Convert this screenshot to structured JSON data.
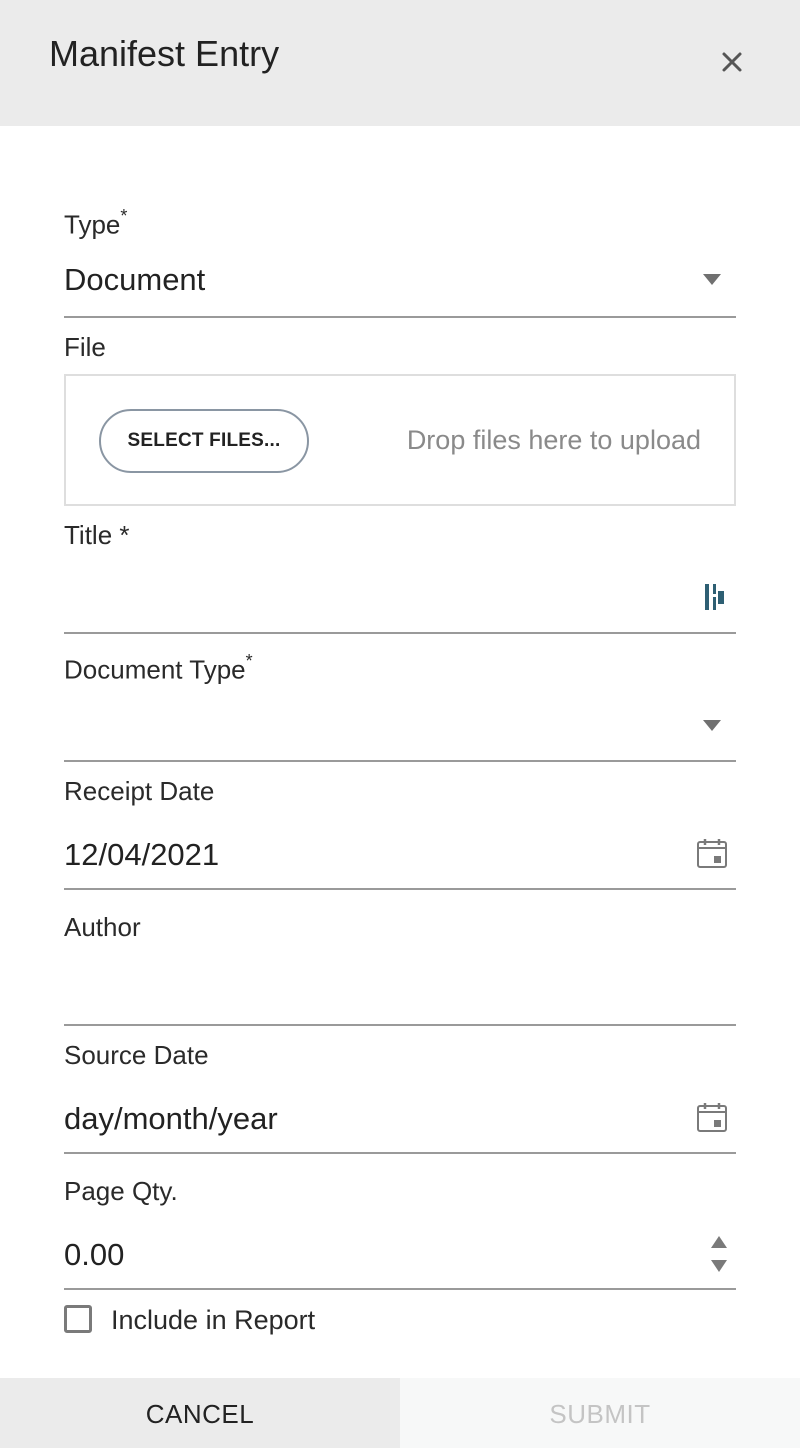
{
  "header": {
    "title": "Manifest Entry",
    "close_icon": "close-icon"
  },
  "form": {
    "type": {
      "label": "Type",
      "required_mark": "*",
      "value": "Document",
      "icon": "dropdown-arrow-icon"
    },
    "file": {
      "label": "File",
      "select_button": "SELECT FILES...",
      "drop_text": "Drop files here to upload"
    },
    "title": {
      "label": "Title *",
      "value": "",
      "icon": "password-manager-icon"
    },
    "document_type": {
      "label": "Document Type",
      "required_mark": "*",
      "value": "",
      "icon": "dropdown-arrow-icon"
    },
    "receipt_date": {
      "label": "Receipt Date",
      "value": "12/04/2021",
      "icon": "calendar-icon"
    },
    "author": {
      "label": "Author",
      "value": ""
    },
    "source_date": {
      "label": "Source Date",
      "placeholder": "day/month/year",
      "icon": "calendar-icon"
    },
    "page_qty": {
      "label": "Page Qty.",
      "value": "0.00",
      "icon": "spinner-arrows-icon"
    },
    "include_in_report": {
      "label": "Include in Report",
      "checked": false
    }
  },
  "footer": {
    "cancel_label": "CANCEL",
    "submit_label": "SUBMIT"
  },
  "colors": {
    "header_bg": "#ebebeb",
    "field_underline": "#9a9a9a",
    "disabled_text": "#c4c4c4",
    "icon_accent": "#2e5f73"
  }
}
